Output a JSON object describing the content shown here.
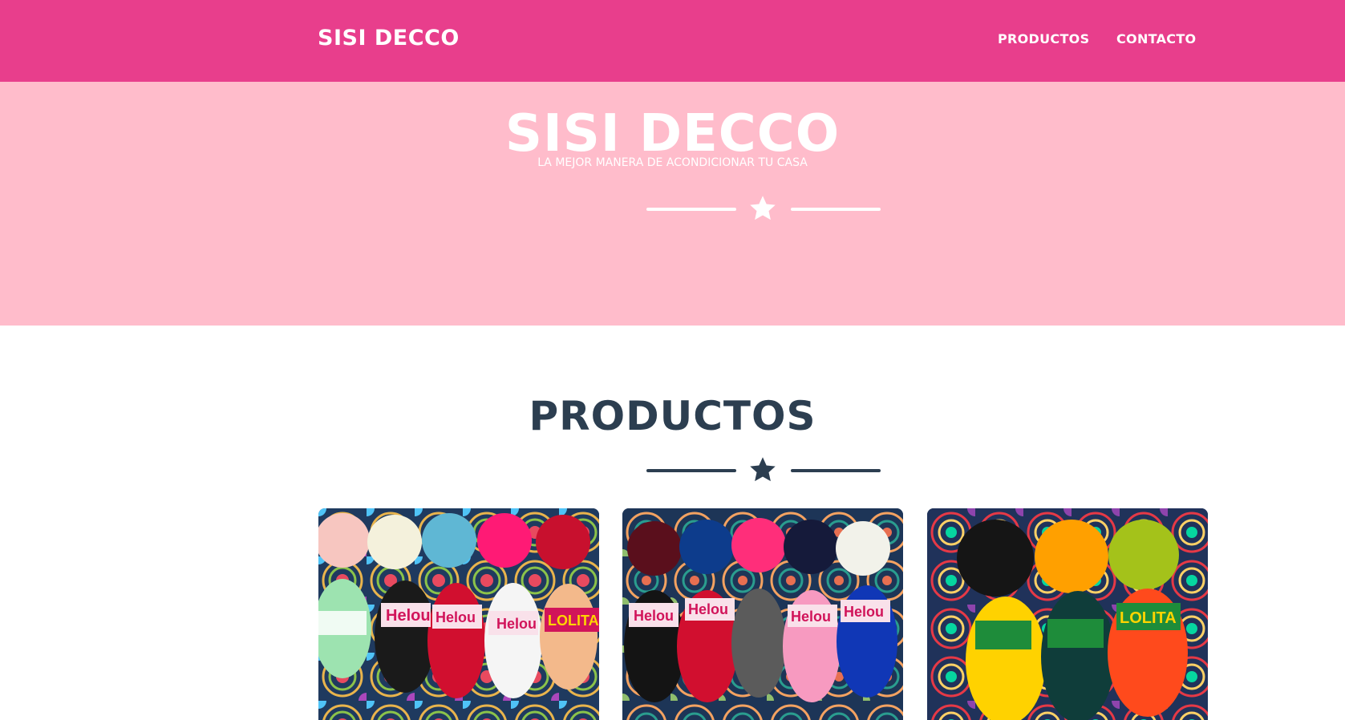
{
  "nav": {
    "brand": "SISI DECCO",
    "links": [
      "PRODUCTOS",
      "CONTACTO"
    ]
  },
  "hero": {
    "title": "SISI DECCO",
    "subtitle": "LA MEJOR MANERA DE ACONDICIONAR TU CASA"
  },
  "products": {
    "heading": "PRODUCTOS",
    "items": [
      {
        "image": "yarn-photo",
        "labels": [
          "Helou",
          "Helou",
          "Helou",
          "LOLITA"
        ]
      },
      {
        "image": "yarn-photo",
        "labels": [
          "Helou",
          "Helou",
          "Helou",
          "Helou"
        ]
      },
      {
        "image": "yarn-photo",
        "labels": [
          "LOLITA"
        ]
      }
    ]
  },
  "colors": {
    "navbar": "#e83e8c",
    "masthead": "#ffbccb",
    "heading": "#2c3e50",
    "white": "#ffffff"
  },
  "icons": [
    "star-icon"
  ]
}
